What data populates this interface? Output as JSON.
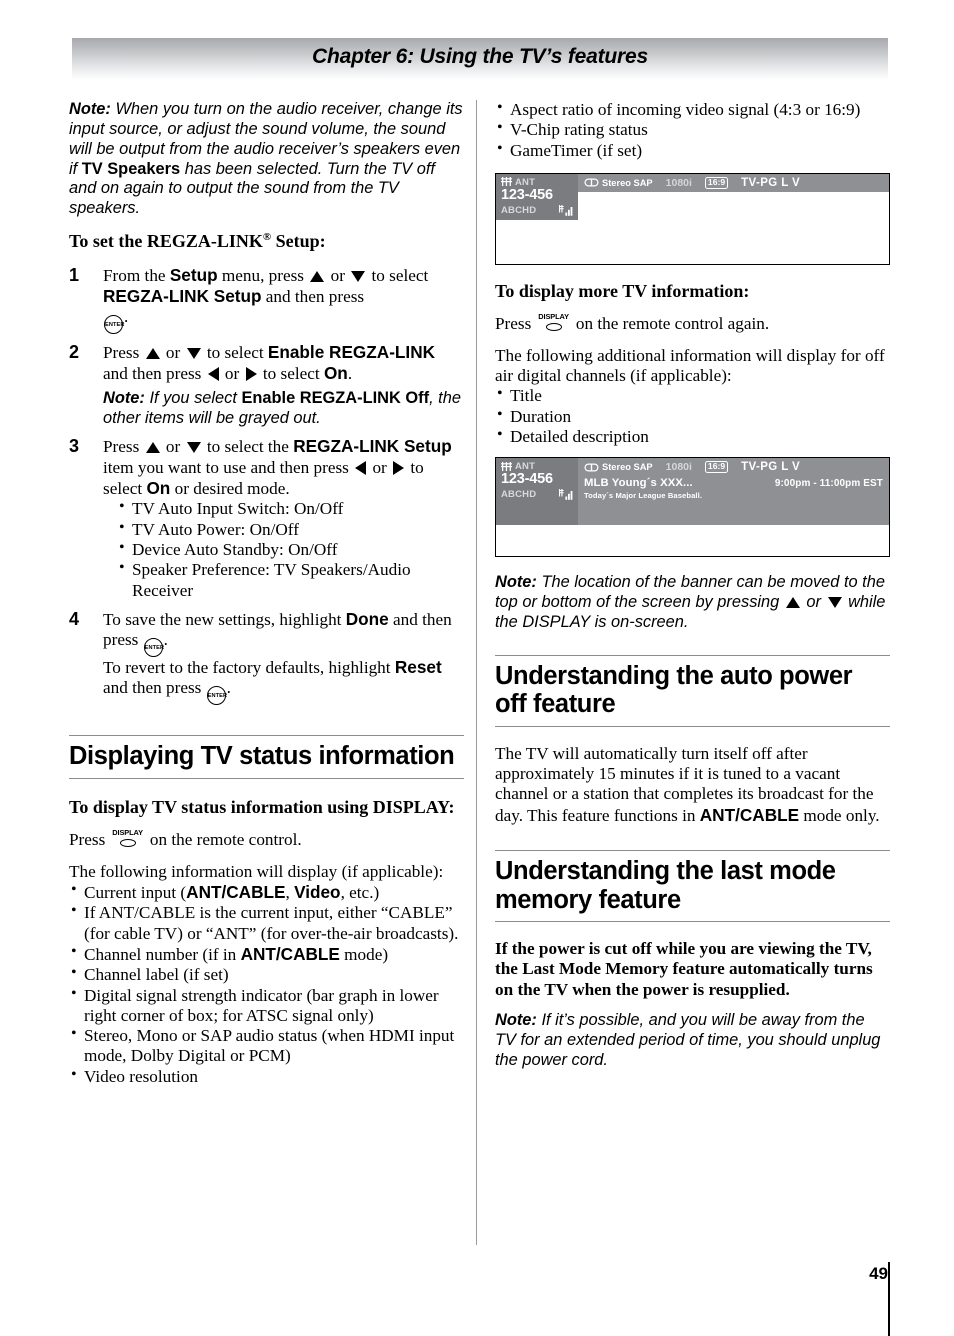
{
  "header": {
    "chapter_title": "Chapter 6: Using the TV’s features"
  },
  "left_column": {
    "note_audio_receiver": {
      "label": "Note:",
      "text_1": " When you turn on the audio receiver, change its input source, or adjust the sound volume, the sound will be output from the audio receiver’s speakers even if ",
      "bold_1": "TV Speakers",
      "text_2": " has been selected. Turn the TV off and on again to output the sound from the TV speakers."
    },
    "regza_heading": "To set the REGZA-LINK® Setup:",
    "steps": [
      {
        "num": "1",
        "t1": "From the ",
        "b1": "Setup",
        "t2": " menu, press ",
        "t3": " or ",
        "t4": " to select ",
        "b2": "REGZA-LINK Setup",
        "t5": " and then press ",
        "t6": "."
      },
      {
        "num": "2",
        "t1": "Press ",
        "t2": " or ",
        "t3": " to select ",
        "b1": "Enable REGZA-LINK",
        "t4": " and then press ",
        "t5": " or ",
        "t6": " to select ",
        "b2": "On",
        "t7": ".",
        "note_label": "Note:",
        "note_t1": " If you select ",
        "note_b1": "Enable REGZA-LINK Off",
        "note_t2": ", the other items will be grayed out."
      },
      {
        "num": "3",
        "t1": "Press ",
        "t2": " or ",
        "t3": " to select the ",
        "b1": "REGZA-LINK Setup",
        "t4": " item you want to use and then press ",
        "t5": " or ",
        "t6": " to select ",
        "b2": "On",
        "t7": " or desired mode.",
        "bullets": [
          "TV Auto Input Switch: On/Off",
          "TV Auto Power: On/Off",
          "Device Auto Standby: On/Off",
          "Speaker Preference: TV Speakers/Audio Receiver"
        ]
      },
      {
        "num": "4",
        "t1": "To save the new settings, highlight ",
        "b1": "Done",
        "t2": " and then press ",
        "t3": ".",
        "t4": "To revert to the factory defaults, highlight ",
        "b2": "Reset",
        "t5": " and then press ",
        "t6": "."
      }
    ],
    "section_heading": "Displaying TV status information",
    "display_subheading": "To display TV status information using DISPLAY:",
    "press_display_t1": "Press ",
    "press_display_t2": " on the remote control.",
    "following_info": "The following information will display (if applicable):",
    "info_bullets": [
      {
        "t1": "Current input (",
        "b1": "ANT/CABLE",
        "t2": ", ",
        "b2": "Video",
        "t3": ", etc.)"
      },
      {
        "t1": "If ANT/CABLE is the current input, either “CABLE” (for cable TV) or “ANT” (for over-the-air broadcasts)."
      },
      {
        "t1": "Channel number (if in ",
        "b1": "ANT/CABLE",
        "t2": " mode)"
      },
      {
        "t1": "Channel label (if set)"
      },
      {
        "t1": "Digital signal strength indicator (bar graph in lower right corner of box; for ATSC signal only)"
      },
      {
        "t1": "Stereo, Mono or SAP audio status (when HDMI input mode, Dolby Digital or PCM)"
      },
      {
        "t1": "Video resolution"
      }
    ]
  },
  "right_column": {
    "top_bullets": [
      "Aspect ratio of incoming video signal (4:3 or 16:9)",
      "V-Chip rating status",
      "GameTimer (if set)"
    ],
    "banner_1": {
      "input_label": "ANT",
      "channel_number": "123-456",
      "channel_label": "ABCHD",
      "audio": "Stereo SAP",
      "resolution": "1080i",
      "aspect_ratio": "16:9",
      "rating": "TV-PG  L  V"
    },
    "more_info_heading": "To display more TV information:",
    "press_display_t1": "Press ",
    "press_display_t2": " on the remote control again.",
    "additional_info": "The following additional information will display for off air digital channels (if applicable):",
    "additional_bullets": [
      "Title",
      "Duration",
      "Detailed description"
    ],
    "banner_2": {
      "input_label": "ANT",
      "channel_number": "123-456",
      "channel_label": "ABCHD",
      "audio": "Stereo SAP",
      "resolution": "1080i",
      "aspect_ratio": "16:9",
      "rating": "TV-PG  L  V",
      "program_title": "MLB Young´s XXX...",
      "program_time": "9:00pm - 11:00pm EST",
      "program_desc": "Today´s Major League Baseball."
    },
    "note_banner": {
      "label": "Note:",
      "t1": " The location of the banner can be moved to the top or bottom of the screen by pressing ",
      "t2": " or ",
      "t3": " while the DISPLAY is on-screen."
    },
    "auto_power_off_heading": "Understanding the auto power off feature",
    "auto_power_off_body": {
      "t1": "The TV will automatically turn itself off after approximately 15 minutes if it is tuned to a vacant channel or a station that completes its broadcast for the day. This feature functions in ",
      "b1": "ANT/CABLE",
      "t2": " mode only."
    },
    "last_mode_heading": "Understanding the last mode memory feature",
    "last_mode_body": "If the power is cut off while you are viewing the TV, the Last Mode Memory feature automatically turns on the TV when the power is resupplied.",
    "note_unplug": {
      "label": "Note:",
      "t1": " If it’s possible, and you will be away from the TV for an extended period of time, you should unplug the power cord."
    }
  },
  "footer": {
    "page_number": "49"
  },
  "icons": {
    "enter": "ENTER",
    "display": "DISPLAY"
  }
}
